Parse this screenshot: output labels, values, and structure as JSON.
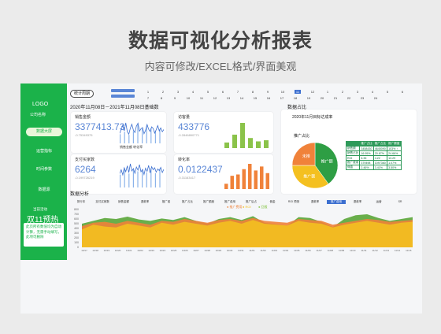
{
  "heading": "数据可视化分析报表",
  "subheading": "内容可修改/EXCEL格式/界面美观",
  "sidebar": {
    "logo": "LOGO",
    "company": "公司名称",
    "items": [
      {
        "label": "数据大屏",
        "active": true
      },
      {
        "label": "运营指标",
        "active": false
      },
      {
        "label": "时间参数",
        "active": false
      },
      {
        "label": "数据源",
        "active": false
      }
    ],
    "promo_label": "当前活动",
    "promo_title": "双11预热",
    "promo_note": "此页所有数值均为自动计算，无需手动填写，此项可删除"
  },
  "toolbar": {
    "period_button": "统计周期",
    "months_row1": [
      "1",
      "2",
      "3",
      "4",
      "5",
      "6",
      "7",
      "8",
      "9",
      "10",
      "11",
      "12"
    ],
    "days_row1": [
      "1",
      "2",
      "3",
      "4",
      "5",
      "6"
    ],
    "days_row2": [
      "7",
      "8",
      "9",
      "10",
      "11",
      "12",
      "13",
      "14",
      "15",
      "16",
      "17",
      "18",
      "19",
      "20",
      "21",
      "22",
      "23",
      "24"
    ],
    "selected_month": "11"
  },
  "date_range": "2020年11月08日－2021年11月08日基础数",
  "share_label": "数据占比",
  "cards": [
    {
      "title": "销售金额",
      "value": "3377413.73",
      "sub": "-0.75349375",
      "color": "#5a86d6",
      "legend": [
        "销售金额",
        "转化率"
      ]
    },
    {
      "title": "访客量",
      "value": "433776",
      "sub": "-0.2846890771",
      "color": "#5a86d6"
    },
    {
      "title": "支付买家数",
      "value": "6264",
      "sub": "-0.199726219",
      "color": "#5a86d6"
    },
    {
      "title": "转化率",
      "value": "0.0122437",
      "sub": "-0.31163417",
      "color": "#5a86d6"
    }
  ],
  "share": {
    "ring_title": "2020年11月目标达成率",
    "pie_title": "推广占比",
    "pie_labels": [
      "推广额",
      "推广额",
      "未推"
    ],
    "table_head": [
      "",
      "推广占比",
      "推广占比",
      "推广额度"
    ],
    "table_rows": [
      [
        "销售额",
        "3458430",
        "4645090",
        "103% ↑"
      ],
      [
        "销售占比",
        "16.95%",
        "20.87%",
        "24.66%"
      ],
      [
        "ROI",
        "6.35",
        "4.22",
        "13.29"
      ],
      [
        "推广费用",
        "379498",
        "1097360",
        "1.07%"
      ],
      [
        "佣金",
        "2.46%",
        "3.41%",
        "3.50%"
      ]
    ]
  },
  "analysis": {
    "label": "数据分析",
    "tabs": [
      "排行本",
      "支付买家数",
      "销售金额",
      "退款率",
      "推广费",
      "推广占比",
      "推广额度",
      "推广费用",
      "推广后占",
      "佣金",
      "ROI 预测",
      "退款率",
      "推广费用",
      "退款率",
      "运营",
      "SR"
    ],
    "selected_tab": 12,
    "legend": [
      "推广费用",
      "ROI",
      "回报"
    ],
    "legend_colors": [
      "#f0823a",
      "#f4c020",
      "#82c341"
    ],
    "y_ticks": [
      "800",
      "700",
      "600",
      "500",
      "400",
      "300",
      "200",
      "100",
      "0"
    ],
    "x_ticks": [
      "10/17",
      "10/18",
      "10/19",
      "10/20",
      "10/21",
      "10/22",
      "10/23",
      "10/24",
      "10/25",
      "10/26",
      "10/27",
      "10/28",
      "10/29",
      "10/30",
      "10/31",
      "11/01",
      "11/02",
      "11/03",
      "11/04",
      "11/05",
      "11/06",
      "11/07",
      "11/08",
      "11/09",
      "11/10",
      "11/11",
      "11/12",
      "11/13",
      "11/14",
      "11/15"
    ]
  },
  "chart_data": [
    {
      "type": "line",
      "title": "",
      "x": [
        1,
        2,
        3,
        4,
        5,
        6,
        7,
        8,
        9,
        10,
        11,
        12,
        13,
        14,
        15,
        16,
        17,
        18,
        19,
        20,
        21,
        22,
        23,
        24,
        25,
        26,
        27,
        28,
        29,
        30
      ],
      "series": [
        {
          "name": "销售金额",
          "values": [
            30,
            42,
            55,
            38,
            62,
            35,
            28,
            46,
            58,
            40,
            33,
            52,
            61,
            37,
            44,
            48,
            29,
            39,
            57,
            43,
            36,
            50,
            45,
            31,
            41,
            54,
            38,
            47,
            35,
            42
          ]
        }
      ]
    },
    {
      "type": "bar",
      "title": "",
      "categories": [
        "1",
        "2",
        "3",
        "4",
        "5",
        "6"
      ],
      "values": [
        10,
        24,
        45,
        18,
        12,
        14
      ]
    },
    {
      "type": "line",
      "title": "",
      "x": [
        1,
        2,
        3,
        4,
        5,
        6,
        7,
        8,
        9,
        10,
        11,
        12,
        13,
        14,
        15,
        16,
        17,
        18,
        19,
        20,
        21,
        22,
        23,
        24,
        25,
        26,
        27,
        28,
        29,
        30
      ],
      "series": [
        {
          "name": "支付买家数",
          "values": [
            35,
            45,
            32,
            50,
            40,
            55,
            38,
            60,
            42,
            48,
            36,
            52,
            44,
            58,
            40,
            46,
            33,
            49,
            41,
            56,
            37,
            53,
            45,
            50,
            39,
            47,
            43,
            51,
            38,
            46
          ]
        }
      ]
    },
    {
      "type": "bar",
      "title": "",
      "categories": [
        "1",
        "2",
        "3",
        "4",
        "5",
        "6",
        "7",
        "8"
      ],
      "values": [
        8,
        20,
        22,
        30,
        38,
        28,
        34,
        24
      ]
    },
    {
      "type": "pie",
      "title": "推广占比",
      "categories": [
        "推广额",
        "推广额",
        "未推"
      ],
      "values": [
        40,
        35,
        25
      ]
    },
    {
      "type": "area",
      "title": "",
      "categories": [
        "10/17",
        "10/18",
        "10/19",
        "10/20",
        "10/21",
        "10/22",
        "10/23",
        "10/24",
        "10/25",
        "10/26",
        "10/27",
        "10/28",
        "10/29",
        "10/30",
        "10/31",
        "11/01",
        "11/02",
        "11/03",
        "11/04",
        "11/05",
        "11/06",
        "11/07",
        "11/08",
        "11/09",
        "11/10",
        "11/11",
        "11/12",
        "11/13",
        "11/14",
        "11/15"
      ],
      "ylim": [
        0,
        800
      ],
      "series": [
        {
          "name": "推广费用",
          "values": [
            450,
            520,
            540,
            500,
            560,
            520,
            480,
            560,
            540,
            600,
            560,
            520,
            580,
            600,
            560,
            620,
            560,
            540,
            520,
            600,
            580,
            560,
            480,
            520,
            560,
            600,
            580,
            540,
            560,
            580
          ]
        },
        {
          "name": "ROI",
          "values": [
            380,
            480,
            440,
            420,
            500,
            460,
            420,
            520,
            480,
            540,
            500,
            460,
            520,
            560,
            500,
            580,
            500,
            480,
            460,
            560,
            520,
            500,
            420,
            480,
            520,
            560,
            520,
            480,
            520,
            540
          ]
        },
        {
          "name": "回报",
          "values": [
            500,
            560,
            620,
            600,
            650,
            590,
            560,
            610,
            580,
            640,
            560,
            500,
            600,
            640,
            580,
            660,
            520,
            490,
            460,
            640,
            620,
            540,
            430,
            600,
            680,
            700,
            620,
            560,
            600,
            640
          ]
        }
      ]
    }
  ]
}
